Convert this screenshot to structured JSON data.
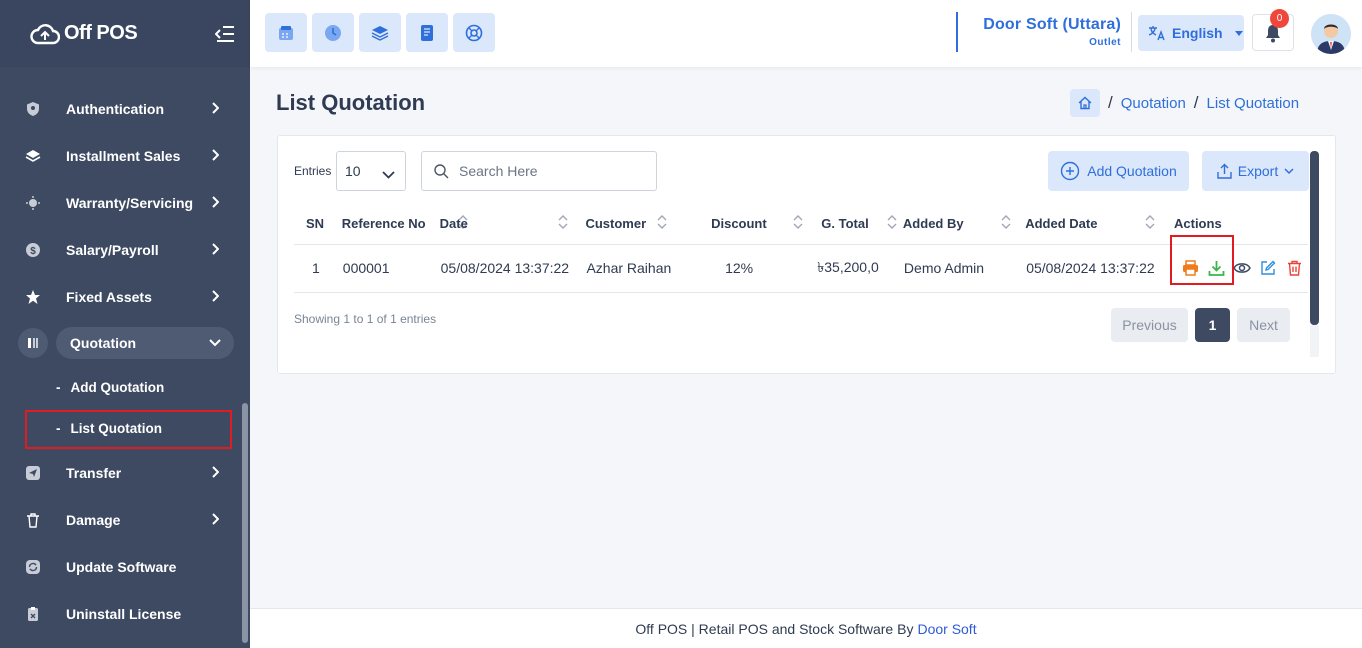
{
  "app": {
    "logo_text": "Off POS"
  },
  "sidebar": {
    "items": [
      {
        "label": "Authentication",
        "icon": "shield-icon"
      },
      {
        "label": "Installment Sales",
        "icon": "layers-icon"
      },
      {
        "label": "Warranty/Servicing",
        "icon": "gear-icon"
      },
      {
        "label": "Salary/Payroll",
        "icon": "dollar-icon"
      },
      {
        "label": "Fixed Assets",
        "icon": "star-icon"
      },
      {
        "label": "Quotation",
        "icon": "quote-icon"
      },
      {
        "label": "Transfer",
        "icon": "send-icon"
      },
      {
        "label": "Damage",
        "icon": "trash-icon"
      },
      {
        "label": "Update Software",
        "icon": "refresh-icon"
      },
      {
        "label": "Uninstall License",
        "icon": "clipboard-icon"
      }
    ],
    "quotation_sub": [
      {
        "label": "Add Quotation"
      },
      {
        "label": "List Quotation"
      }
    ],
    "dash": "-"
  },
  "topbar": {
    "outlet_name": "Door Soft (Uttara)",
    "outlet_sub": "Outlet",
    "language": "English",
    "notification_count": "0"
  },
  "page": {
    "title": "List Quotation",
    "breadcrumb": [
      "Quotation",
      "List Quotation"
    ],
    "breadcrumb_sep": "/"
  },
  "table_controls": {
    "entries_label": "Entries",
    "entries_value": "10",
    "search_placeholder": "Search Here",
    "add_label": "Add Quotation",
    "export_label": "Export"
  },
  "table": {
    "columns": [
      "SN",
      "Reference No",
      "Date",
      "Customer",
      "Discount",
      "G. Total",
      "Added By",
      "Added Date",
      "Actions"
    ],
    "rows": [
      {
        "sn": "1",
        "ref": "000001",
        "date": "05/08/2024 13:37:22",
        "customer": "Azhar Raihan",
        "discount": "12%",
        "total": "৳35,200,0",
        "added_by": "Demo Admin",
        "added_date": "05/08/2024 13:37:22"
      }
    ]
  },
  "pagination": {
    "showing": "Showing 1 to 1 of 1 entries",
    "prev": "Previous",
    "current": "1",
    "next": "Next"
  },
  "footer": {
    "text": "Off POS | Retail POS and Stock Software By",
    "link": "Door Soft"
  },
  "colors": {
    "sidebar_bg": "#3d4a62",
    "accent": "#2f6fdb",
    "highlight_red": "#e11b22",
    "print_orange": "#f07b1a",
    "download_green": "#3ab54a",
    "delete_red": "#e8443a"
  }
}
